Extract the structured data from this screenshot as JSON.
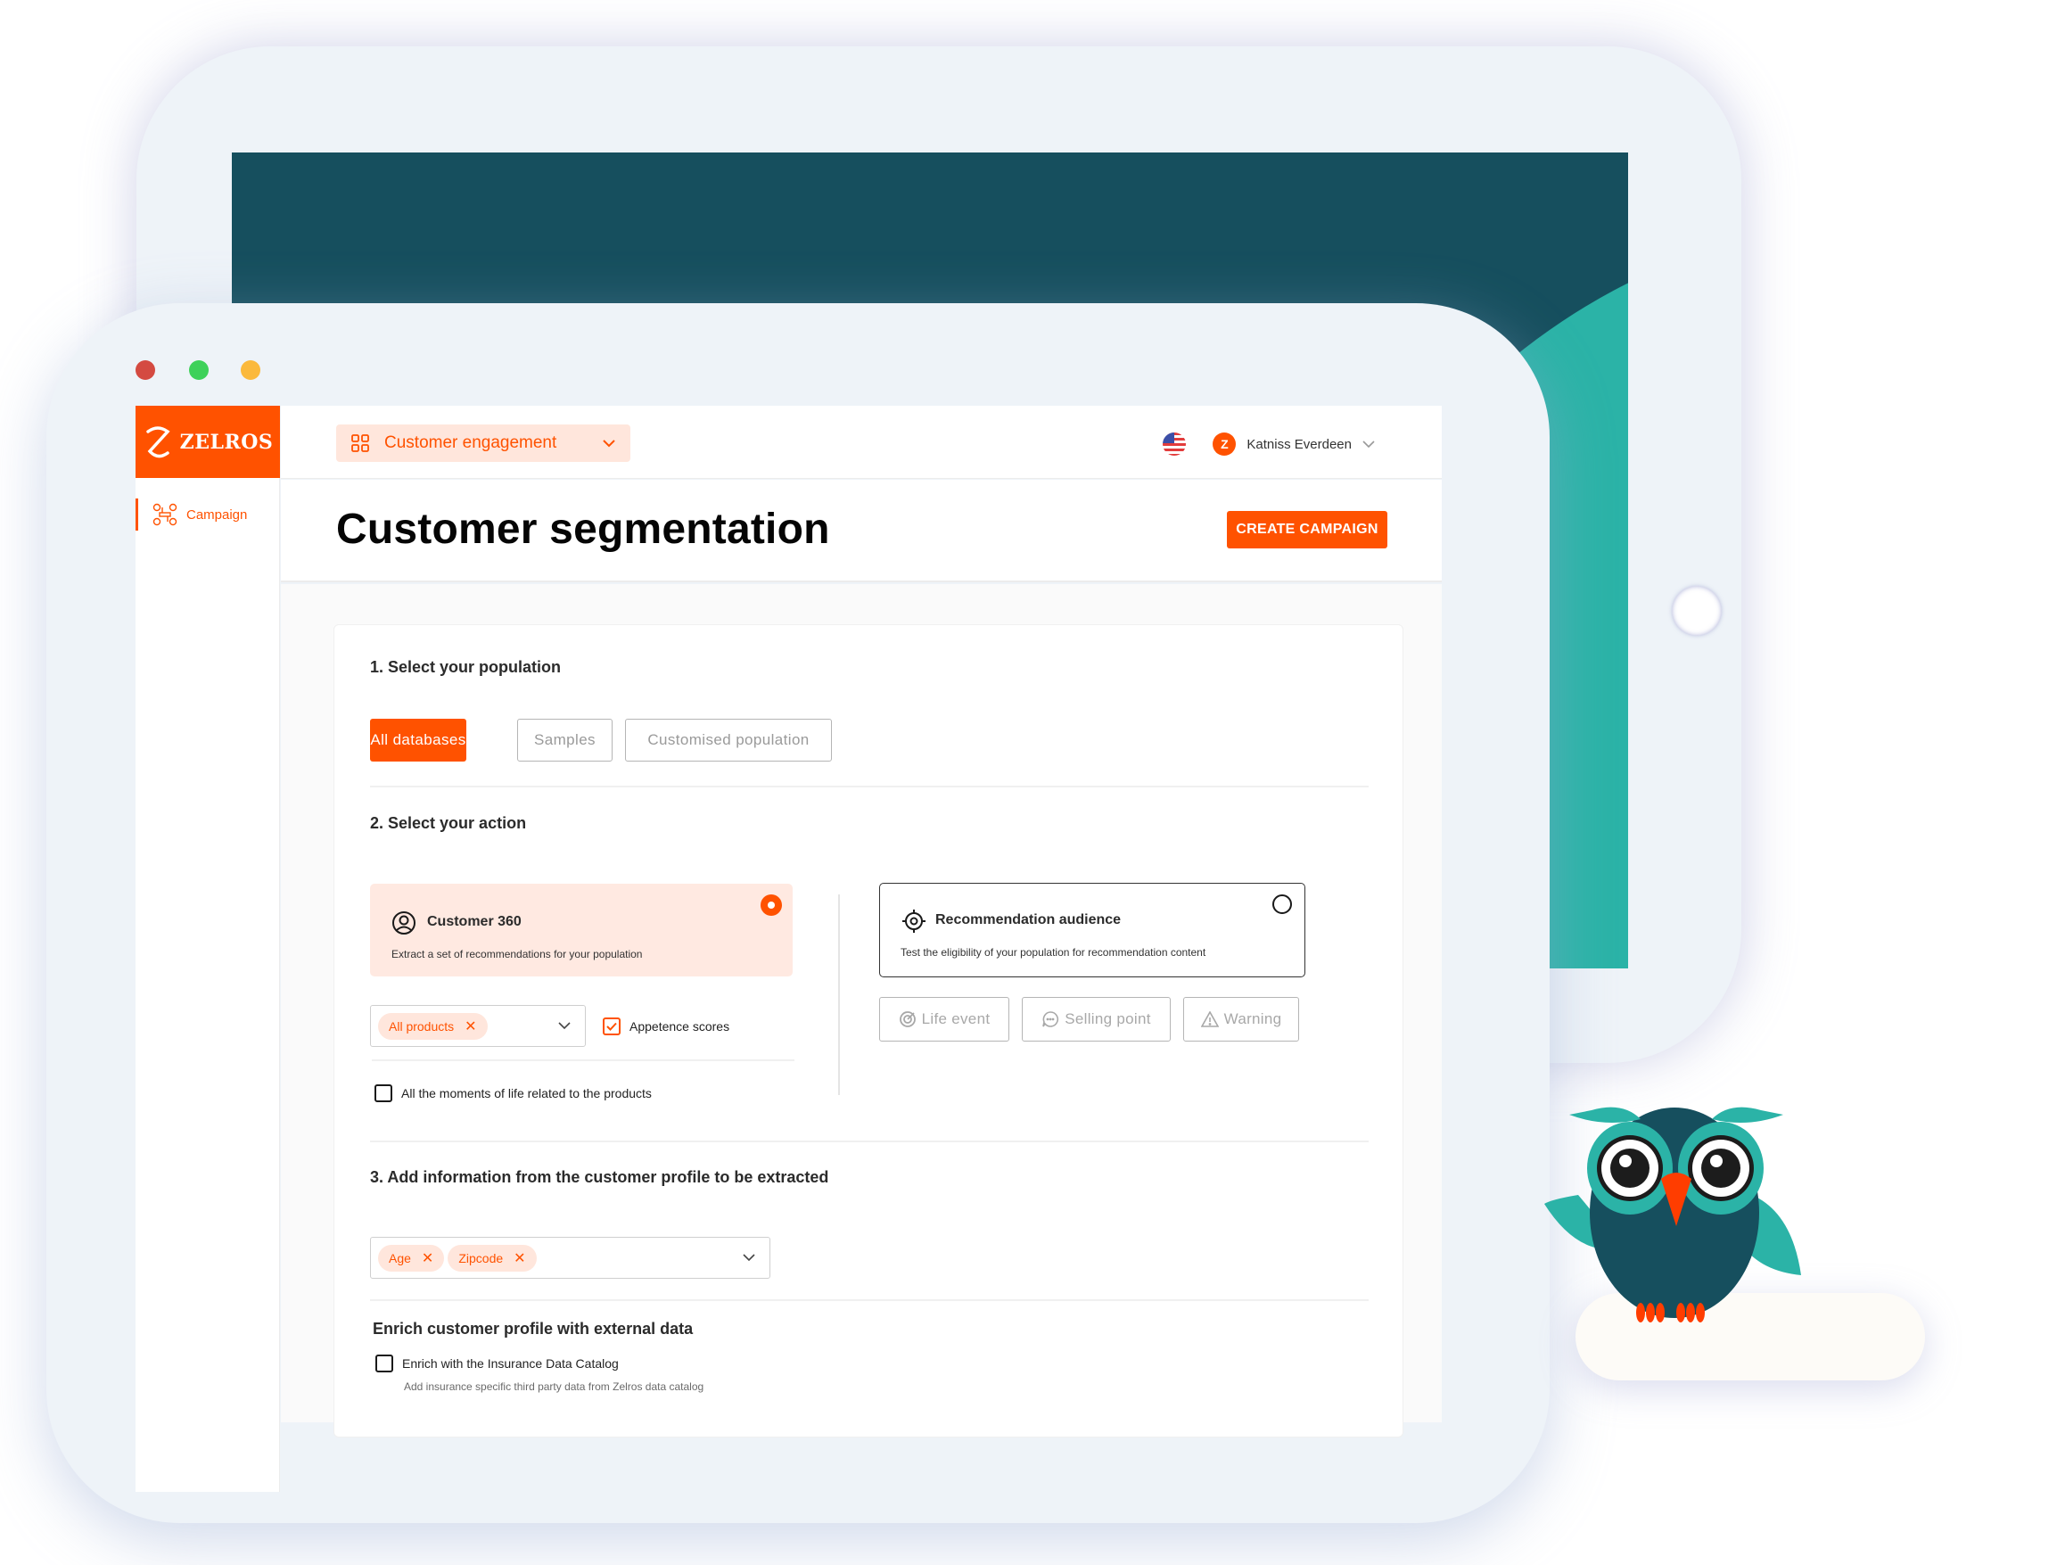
{
  "window": {
    "traffic_lights": [
      "close",
      "minimize",
      "maximize"
    ]
  },
  "brand": {
    "name": "ZELROS",
    "accent_color": "#ff5200",
    "accent_light": "#ffe6dc"
  },
  "sidebar": {
    "items": [
      {
        "label": "Campaign",
        "icon": "campaign-network-icon",
        "active": true
      }
    ]
  },
  "topbar": {
    "workspace_selector": {
      "label": "Customer engagement",
      "icon": "grid-icon"
    },
    "language": "en-US",
    "user": {
      "name": "Katniss Everdeen",
      "avatar_initial": "Z"
    }
  },
  "page": {
    "title": "Customer segmentation",
    "create_button": "CREATE CAMPAIGN"
  },
  "form": {
    "section1": {
      "title": "1. Select your population",
      "options": [
        {
          "label": "All databases",
          "selected": true
        },
        {
          "label": "Samples",
          "selected": false
        },
        {
          "label": "Customised population",
          "selected": false
        }
      ]
    },
    "section2": {
      "title": "2. Select your action",
      "customer360": {
        "title": "Customer 360",
        "description": "Extract a set of recommendations for your population",
        "selected": true,
        "products_select": {
          "chips": [
            "All products"
          ]
        },
        "appetence_checkbox": {
          "label": "Appetence scores",
          "checked": true
        },
        "moments_checkbox": {
          "label": "All the moments of life related to the products",
          "checked": false
        }
      },
      "recommendation_audience": {
        "title": "Recommendation audience",
        "description": "Test the eligibility of your population for recommendation content",
        "selected": false,
        "options": [
          {
            "label": "Life event",
            "icon": "life-event-icon"
          },
          {
            "label": "Selling point",
            "icon": "chat-bubble-icon"
          },
          {
            "label": "Warning",
            "icon": "warning-icon"
          }
        ]
      }
    },
    "section3": {
      "title": "3. Add information from the customer profile to be extracted",
      "chips": [
        "Age",
        "Zipcode"
      ]
    },
    "enrich": {
      "title": "Enrich customer profile with external data",
      "checkbox_label": "Enrich with the Insurance Data Catalog",
      "checked": false,
      "description": "Add insurance specific third party data from Zelros data catalog"
    }
  }
}
